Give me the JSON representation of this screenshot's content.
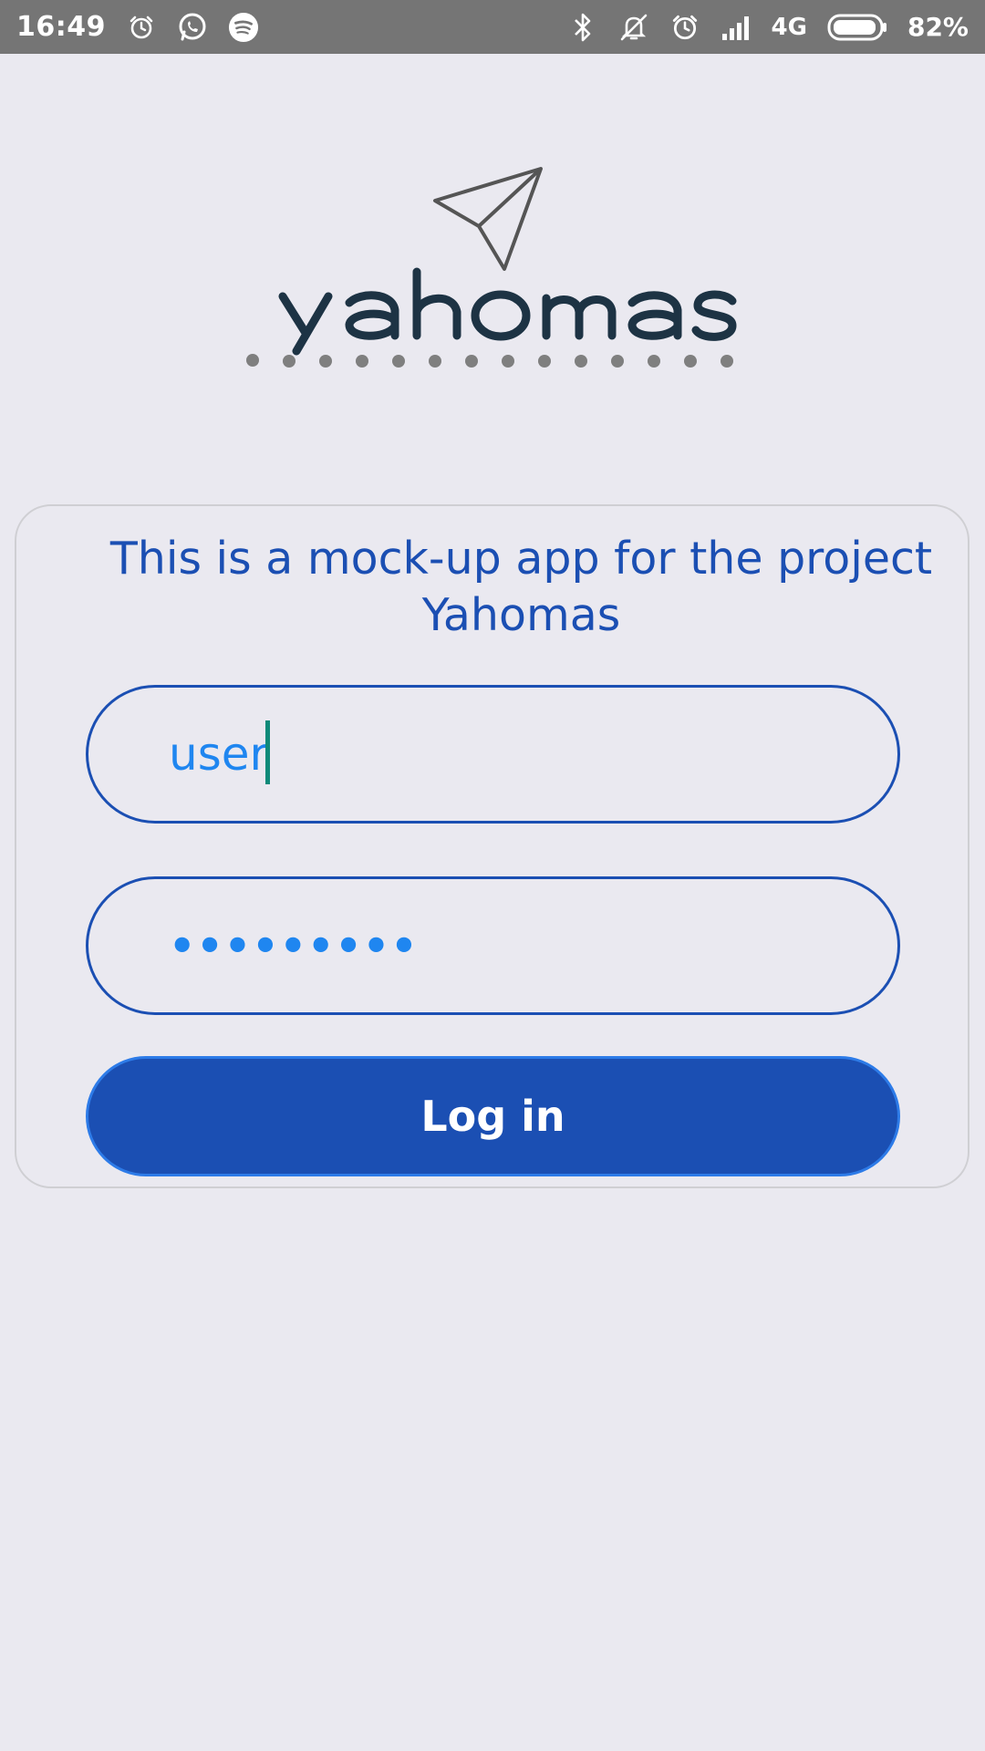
{
  "status_bar": {
    "time": "16:49",
    "network": "4G",
    "battery_percent": "82%",
    "icons_left": [
      "alarm-icon",
      "whatsapp-icon",
      "spotify-icon"
    ],
    "icons_right": [
      "bluetooth-icon",
      "mute-icon",
      "alarm-icon",
      "signal-icon",
      "battery-icon"
    ]
  },
  "logo": {
    "text": "yahomas"
  },
  "card": {
    "title": "This is a mock-up app for the project Yahomas"
  },
  "form": {
    "username_value": "user",
    "password_mask": "•••••••••",
    "login_label": "Log in"
  },
  "colors": {
    "background": "#eae9f0",
    "status_bar": "#757575",
    "primary": "#1b4fb3",
    "input_text": "#1f86f0"
  }
}
